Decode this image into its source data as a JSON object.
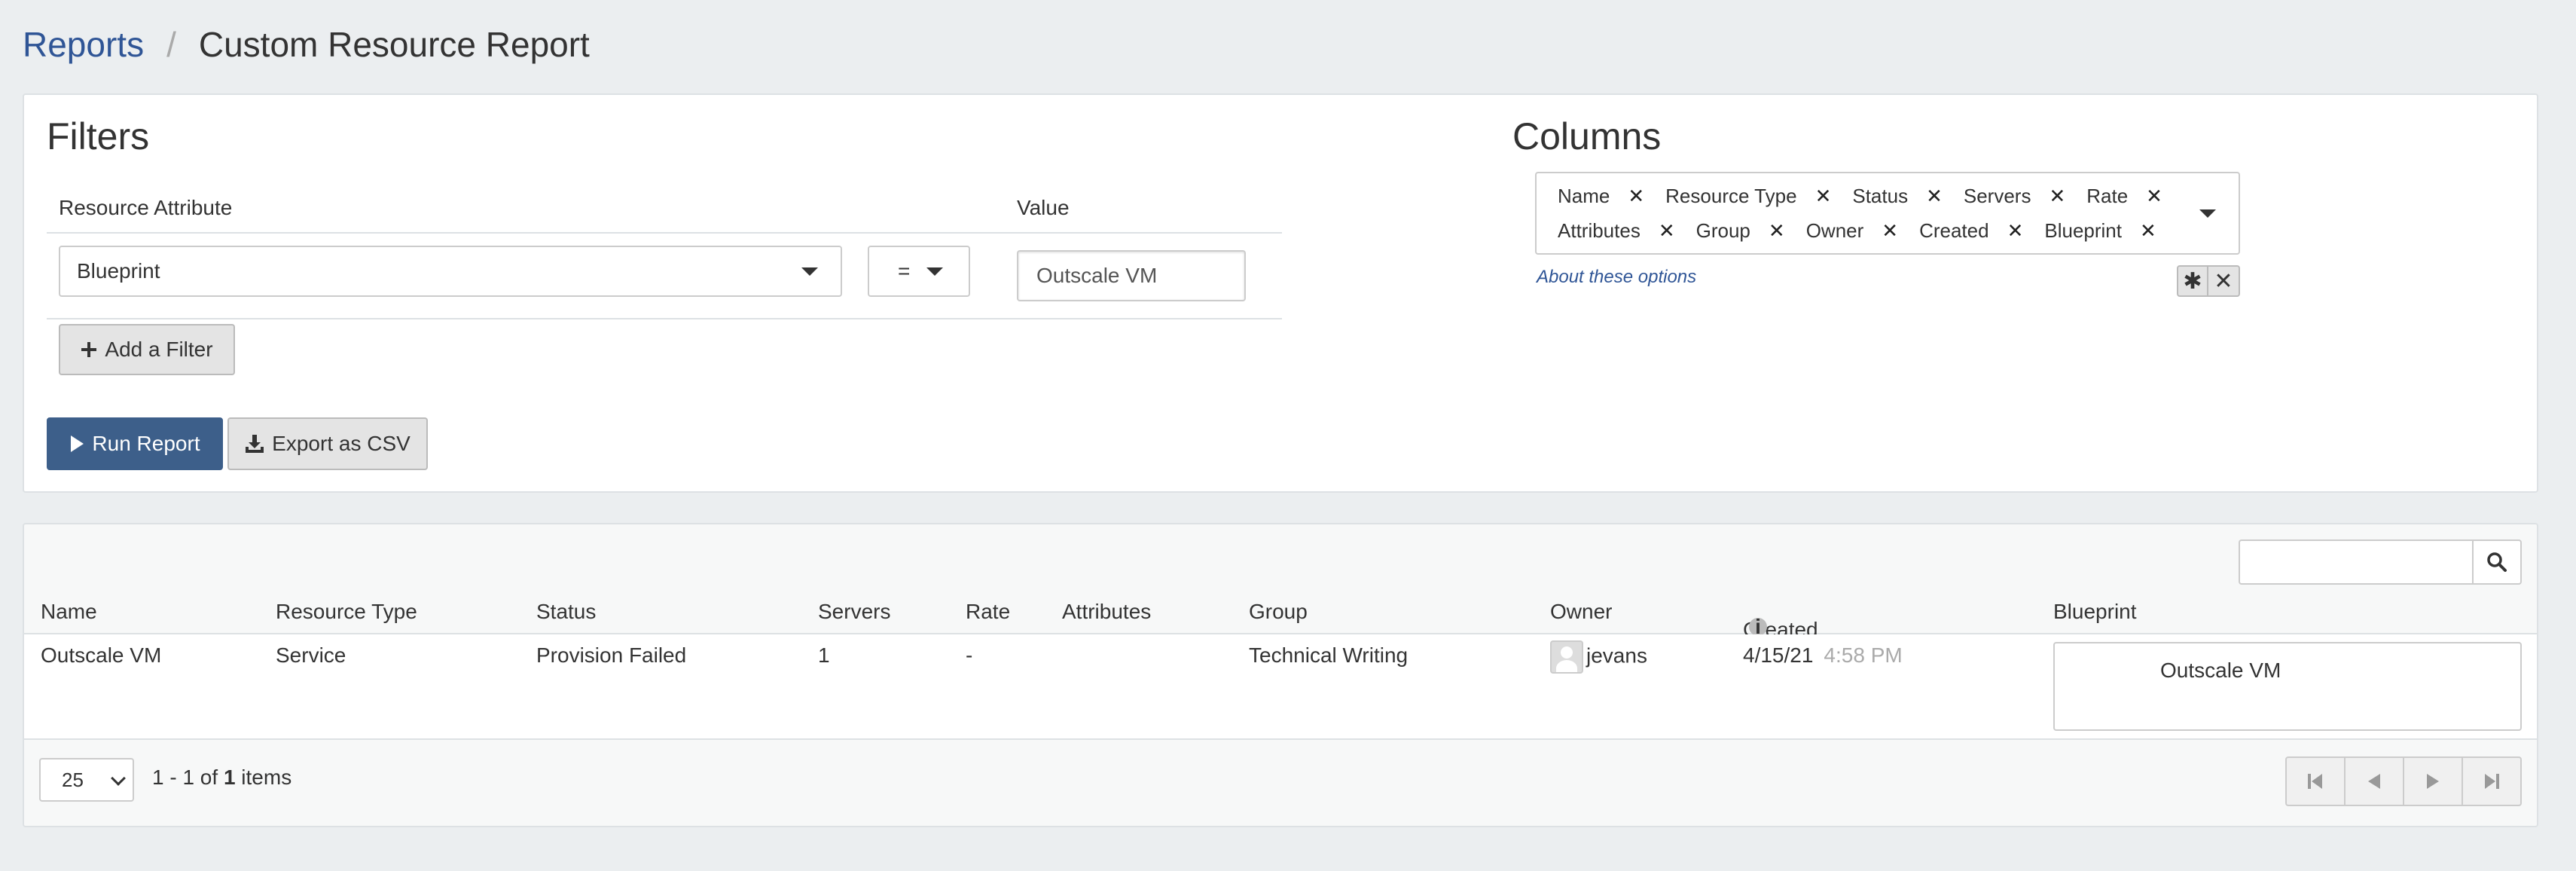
{
  "breadcrumb": {
    "root": "Reports",
    "separator": "/",
    "current": "Custom Resource Report"
  },
  "filters": {
    "title": "Filters",
    "header_attribute": "Resource Attribute",
    "header_value": "Value",
    "rows": [
      {
        "attribute": "Blueprint",
        "operator": "=",
        "value": "Outscale VM"
      }
    ],
    "add_filter_label": "Add a Filter"
  },
  "actions": {
    "run_label": "Run Report",
    "export_label": "Export as CSV"
  },
  "columns": {
    "title": "Columns",
    "selected": [
      "Name",
      "Resource Type",
      "Status",
      "Servers",
      "Rate",
      "Attributes",
      "Group",
      "Owner",
      "Created",
      "Blueprint"
    ],
    "about_label": "About these options",
    "select_all_glyph": "✱",
    "clear_all_glyph": "✕"
  },
  "results": {
    "headers": [
      "Name",
      "Resource Type",
      "Status",
      "Servers",
      "Rate",
      "Attributes",
      "Group",
      "Owner",
      "Created",
      "Blueprint"
    ],
    "rows": [
      {
        "name": "Outscale VM",
        "resource_type": "Service",
        "status": "Provision Failed",
        "servers": "1",
        "rate": "-",
        "attributes": "",
        "group": "Technical Writing",
        "owner": "jevans",
        "created_date": "4/15/21",
        "created_time": "4:58 PM",
        "blueprint": "Outscale VM"
      }
    ],
    "page_size": "25",
    "page_info_prefix": "1 - 1 of ",
    "page_info_total": "1",
    "page_info_suffix": " items"
  },
  "colors": {
    "accent": "#3d5f8a",
    "link": "#2f5596",
    "background": "#ebeef0"
  }
}
